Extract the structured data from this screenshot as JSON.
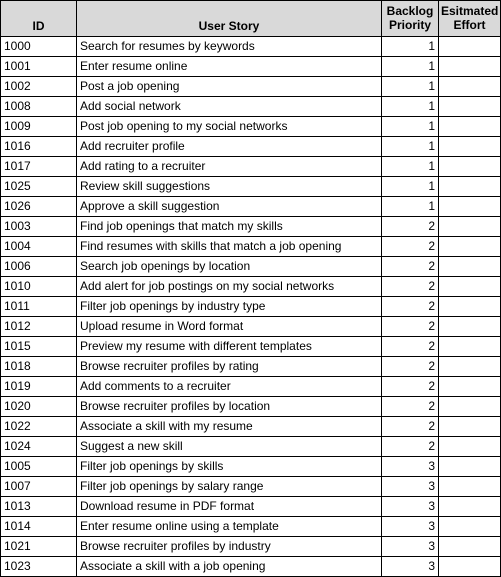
{
  "table": {
    "columns": [
      {
        "key": "id",
        "label": "ID",
        "label_line1": "ID",
        "label_line2": ""
      },
      {
        "key": "story",
        "label": "User Story",
        "label_line1": "User Story",
        "label_line2": ""
      },
      {
        "key": "priority",
        "label": "Backlog Priority",
        "label_line1": "Backlog",
        "label_line2": "Priority"
      },
      {
        "key": "effort",
        "label": "Esitmated Effort",
        "label_line1": "Esitmated",
        "label_line2": "Effort"
      }
    ],
    "header_background": "#d9d9d9",
    "grid_color": "#000000",
    "rows": [
      {
        "id": "1000",
        "story": "Search for resumes by keywords",
        "priority": "1",
        "effort": ""
      },
      {
        "id": "1001",
        "story": "Enter resume online",
        "priority": "1",
        "effort": ""
      },
      {
        "id": "1002",
        "story": "Post a job opening",
        "priority": "1",
        "effort": ""
      },
      {
        "id": "1008",
        "story": "Add social network",
        "priority": "1",
        "effort": ""
      },
      {
        "id": "1009",
        "story": "Post job opening to my social networks",
        "priority": "1",
        "effort": ""
      },
      {
        "id": "1016",
        "story": "Add recruiter profile",
        "priority": "1",
        "effort": ""
      },
      {
        "id": "1017",
        "story": "Add rating to a recruiter",
        "priority": "1",
        "effort": ""
      },
      {
        "id": "1025",
        "story": "Review skill suggestions",
        "priority": "1",
        "effort": ""
      },
      {
        "id": "1026",
        "story": "Approve a skill suggestion",
        "priority": "1",
        "effort": ""
      },
      {
        "id": "1003",
        "story": "Find job openings that match my skills",
        "priority": "2",
        "effort": ""
      },
      {
        "id": "1004",
        "story": "Find resumes with skills that match a job opening",
        "priority": "2",
        "effort": ""
      },
      {
        "id": "1006",
        "story": "Search job openings by location",
        "priority": "2",
        "effort": ""
      },
      {
        "id": "1010",
        "story": "Add alert for job postings on my social networks",
        "priority": "2",
        "effort": ""
      },
      {
        "id": "1011",
        "story": "Filter job openings by industry type",
        "priority": "2",
        "effort": ""
      },
      {
        "id": "1012",
        "story": "Upload resume in Word format",
        "priority": "2",
        "effort": ""
      },
      {
        "id": "1015",
        "story": "Preview my resume with different templates",
        "priority": "2",
        "effort": ""
      },
      {
        "id": "1018",
        "story": "Browse recruiter profiles by rating",
        "priority": "2",
        "effort": ""
      },
      {
        "id": "1019",
        "story": "Add comments to a recruiter",
        "priority": "2",
        "effort": ""
      },
      {
        "id": "1020",
        "story": "Browse recruiter profiles by location",
        "priority": "2",
        "effort": ""
      },
      {
        "id": "1022",
        "story": "Associate a skill with my resume",
        "priority": "2",
        "effort": ""
      },
      {
        "id": "1024",
        "story": "Suggest a new skill",
        "priority": "2",
        "effort": ""
      },
      {
        "id": "1005",
        "story": "Filter job openings by skills",
        "priority": "3",
        "effort": ""
      },
      {
        "id": "1007",
        "story": "Filter job openings by salary range",
        "priority": "3",
        "effort": ""
      },
      {
        "id": "1013",
        "story": "Download resume in PDF format",
        "priority": "3",
        "effort": ""
      },
      {
        "id": "1014",
        "story": "Enter resume online using a template",
        "priority": "3",
        "effort": ""
      },
      {
        "id": "1021",
        "story": "Browse recruiter profiles by industry",
        "priority": "3",
        "effort": ""
      },
      {
        "id": "1023",
        "story": "Associate a skill with a job opening",
        "priority": "3",
        "effort": ""
      }
    ]
  }
}
